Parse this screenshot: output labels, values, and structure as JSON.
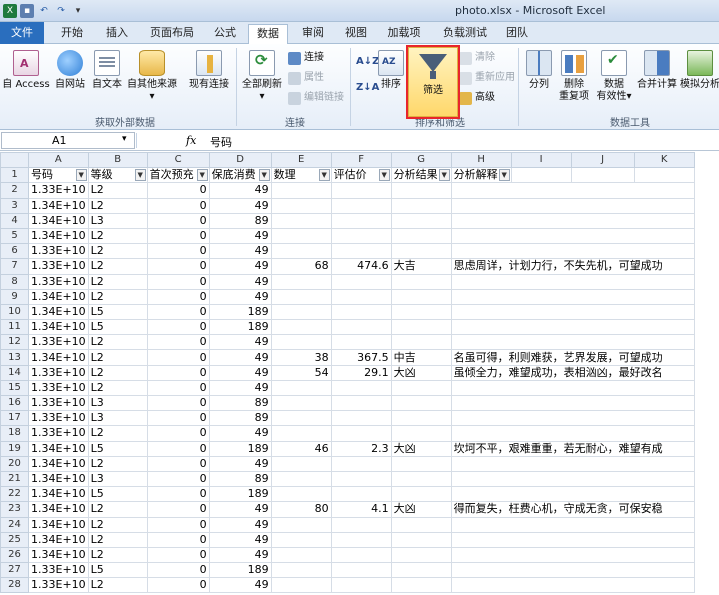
{
  "window": {
    "title": "photo.xlsx - Microsoft Excel"
  },
  "qat": {
    "save_icon": "save-icon",
    "undo_icon": "undo-icon",
    "redo_icon": "redo-icon"
  },
  "tabs": [
    "文件",
    "开始",
    "插入",
    "页面布局",
    "公式",
    "数据",
    "审阅",
    "视图",
    "加载项",
    "负载测试",
    "团队"
  ],
  "ribbon": {
    "get_external": {
      "access": "自 Access",
      "web": "自网站",
      "text": "自文本",
      "other": "自其他来源",
      "existing": "现有连接",
      "label": "获取外部数据"
    },
    "connections": {
      "refresh": "全部刷新",
      "connections": "连接",
      "properties": "属性",
      "edit_links": "编辑链接",
      "label": "连接"
    },
    "sort_filter": {
      "sort": "排序",
      "filter": "筛选",
      "clear": "清除",
      "reapply": "重新应用",
      "advanced": "高级",
      "label": "排序和筛选"
    },
    "data_tools": {
      "split": "分列",
      "remove_dup_1": "删除",
      "remove_dup_2": "重复项",
      "validation_1": "数据",
      "validation_2": "有效性",
      "consolidate": "合并计算",
      "whatif": "模拟分析",
      "label": "数据工具"
    }
  },
  "formula_bar": {
    "cell_ref": "A1",
    "fx": "fx",
    "content": "号码"
  },
  "sheet": {
    "columns": [
      "A",
      "B",
      "C",
      "D",
      "E",
      "F",
      "G",
      "H",
      "I",
      "J",
      "K"
    ],
    "header": [
      "号码",
      "等级",
      "首次预充",
      "保底消费",
      "数理",
      "评估价",
      "分析结果",
      "分析解释"
    ],
    "rows": [
      [
        "2",
        "1.33E+10",
        "L2",
        "0",
        "49",
        "",
        "",
        "",
        ""
      ],
      [
        "3",
        "1.34E+10",
        "L2",
        "0",
        "49",
        "",
        "",
        "",
        ""
      ],
      [
        "4",
        "1.34E+10",
        "L3",
        "0",
        "89",
        "",
        "",
        "",
        ""
      ],
      [
        "5",
        "1.34E+10",
        "L2",
        "0",
        "49",
        "",
        "",
        "",
        ""
      ],
      [
        "6",
        "1.33E+10",
        "L2",
        "0",
        "49",
        "",
        "",
        "",
        ""
      ],
      [
        "7",
        "1.33E+10",
        "L2",
        "0",
        "49",
        "68",
        "474.6",
        "大吉",
        "思虑周详，计划力行，不失先机，可望成功"
      ],
      [
        "8",
        "1.33E+10",
        "L2",
        "0",
        "49",
        "",
        "",
        "",
        ""
      ],
      [
        "9",
        "1.34E+10",
        "L2",
        "0",
        "49",
        "",
        "",
        "",
        ""
      ],
      [
        "10",
        "1.34E+10",
        "L5",
        "0",
        "189",
        "",
        "",
        "",
        ""
      ],
      [
        "11",
        "1.34E+10",
        "L5",
        "0",
        "189",
        "",
        "",
        "",
        ""
      ],
      [
        "12",
        "1.33E+10",
        "L2",
        "0",
        "49",
        "",
        "",
        "",
        ""
      ],
      [
        "13",
        "1.34E+10",
        "L2",
        "0",
        "49",
        "38",
        "367.5",
        "中吉",
        "名虽可得，利则难获，艺界发展，可望成功"
      ],
      [
        "14",
        "1.33E+10",
        "L2",
        "0",
        "49",
        "54",
        "29.1",
        "大凶",
        "虽倾全力，难望成功，表相汹凶，最好改名"
      ],
      [
        "15",
        "1.33E+10",
        "L2",
        "0",
        "49",
        "",
        "",
        "",
        ""
      ],
      [
        "16",
        "1.33E+10",
        "L3",
        "0",
        "89",
        "",
        "",
        "",
        ""
      ],
      [
        "17",
        "1.33E+10",
        "L3",
        "0",
        "89",
        "",
        "",
        "",
        ""
      ],
      [
        "18",
        "1.33E+10",
        "L2",
        "0",
        "49",
        "",
        "",
        "",
        ""
      ],
      [
        "19",
        "1.34E+10",
        "L5",
        "0",
        "189",
        "46",
        "2.3",
        "大凶",
        "坎坷不平，艰难重重，若无耐心，难望有成"
      ],
      [
        "20",
        "1.34E+10",
        "L2",
        "0",
        "49",
        "",
        "",
        "",
        ""
      ],
      [
        "21",
        "1.34E+10",
        "L3",
        "0",
        "89",
        "",
        "",
        "",
        ""
      ],
      [
        "22",
        "1.34E+10",
        "L5",
        "0",
        "189",
        "",
        "",
        "",
        ""
      ],
      [
        "23",
        "1.34E+10",
        "L2",
        "0",
        "49",
        "80",
        "4.1",
        "大凶",
        "得而复失，枉费心机，守成无贪，可保安稳"
      ],
      [
        "24",
        "1.34E+10",
        "L2",
        "0",
        "49",
        "",
        "",
        "",
        ""
      ],
      [
        "25",
        "1.34E+10",
        "L2",
        "0",
        "49",
        "",
        "",
        "",
        ""
      ],
      [
        "26",
        "1.34E+10",
        "L2",
        "0",
        "49",
        "",
        "",
        "",
        ""
      ],
      [
        "27",
        "1.33E+10",
        "L5",
        "0",
        "189",
        "",
        "",
        "",
        ""
      ],
      [
        "28",
        "1.33E+10",
        "L2",
        "0",
        "49",
        "",
        "",
        "",
        ""
      ]
    ]
  }
}
